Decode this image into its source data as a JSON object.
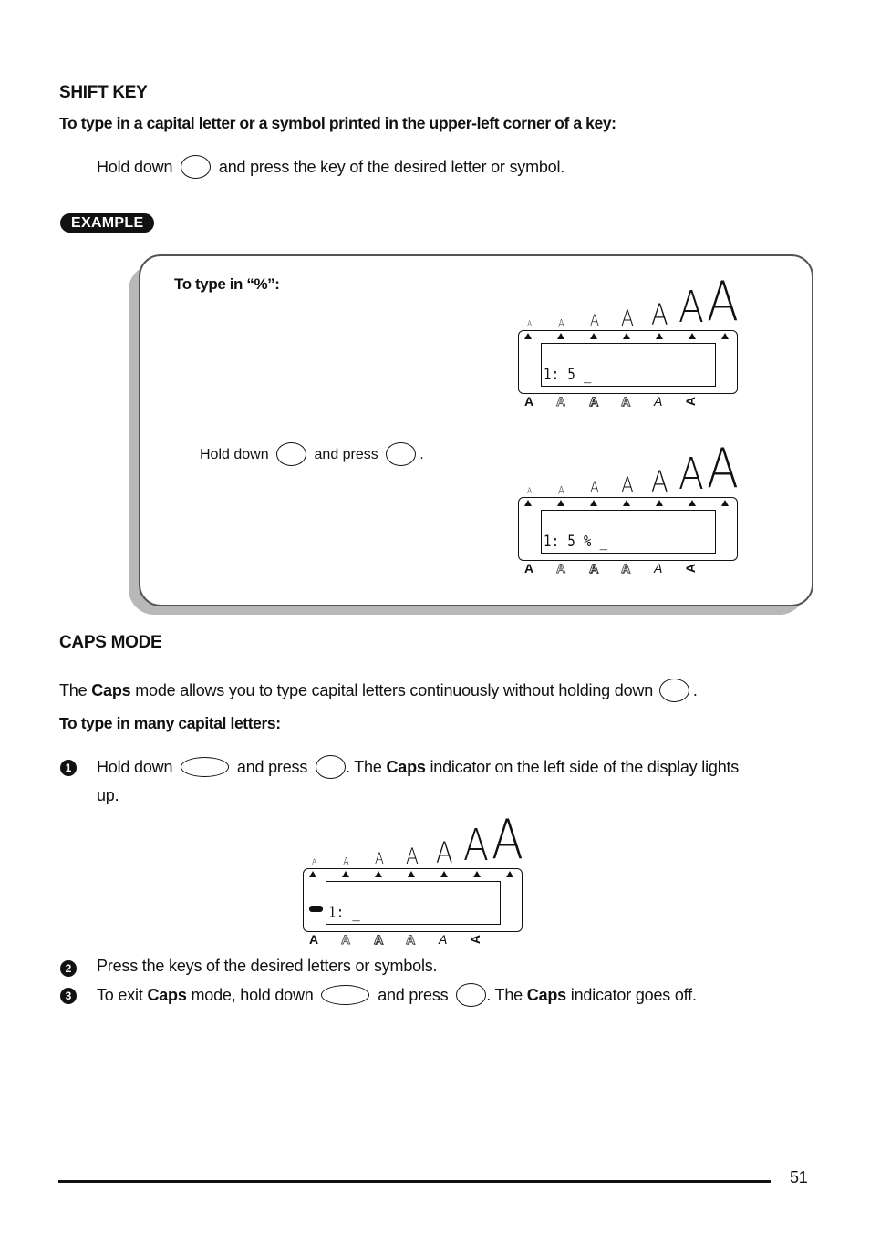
{
  "shift_key": {
    "heading": "SHIFT KEY",
    "subheading": "To type in a capital letter or a symbol printed in the upper-left corner of a key:",
    "instruction_before": "Hold down",
    "instruction_after": "and press the key of the desired letter or symbol."
  },
  "example": {
    "badge": "EXAMPLE",
    "title": "To type in “%”:",
    "step_hold": "Hold down",
    "step_press": "and press",
    "step_end": ".",
    "display_before": "1: 5 _",
    "display_after": "1: 5 % _"
  },
  "lcd": {
    "size_indicators": [
      "A",
      "A",
      "A",
      "A",
      "A",
      "A",
      "A"
    ],
    "style_indicators": [
      {
        "glyph": "A",
        "style": "bold"
      },
      {
        "glyph": "A",
        "style": "outline"
      },
      {
        "glyph": "A",
        "style": "shadow"
      },
      {
        "glyph": "A",
        "style": "outline-shadow"
      },
      {
        "glyph": "A",
        "style": "italic"
      },
      {
        "glyph": "A",
        "style": "vertical"
      }
    ]
  },
  "caps_mode": {
    "heading": "CAPS MODE",
    "intro_1": "The",
    "intro_bold": "Caps",
    "intro_2": "mode allows you to type capital letters continuously without holding down",
    "intro_end": ".",
    "subheading": "To type in many capital letters:",
    "steps": [
      {
        "number": "1",
        "text_hold": "Hold down",
        "text_press": "and press",
        "text_3": ". The",
        "text_bold": "Caps",
        "text_4": "indicator on the left side of the display lights",
        "text_5": "up."
      },
      {
        "number": "2",
        "text": "Press the keys of the desired letters or symbols."
      },
      {
        "number": "3",
        "text_1": "To exit",
        "text_bold": "Caps",
        "text_2": "mode, hold down",
        "text_press": "and press",
        "text_3": ". The",
        "text_bold_2": "Caps",
        "text_4": "indicator goes off."
      }
    ],
    "display": "1: _"
  },
  "footer": {
    "page_number": "51"
  }
}
